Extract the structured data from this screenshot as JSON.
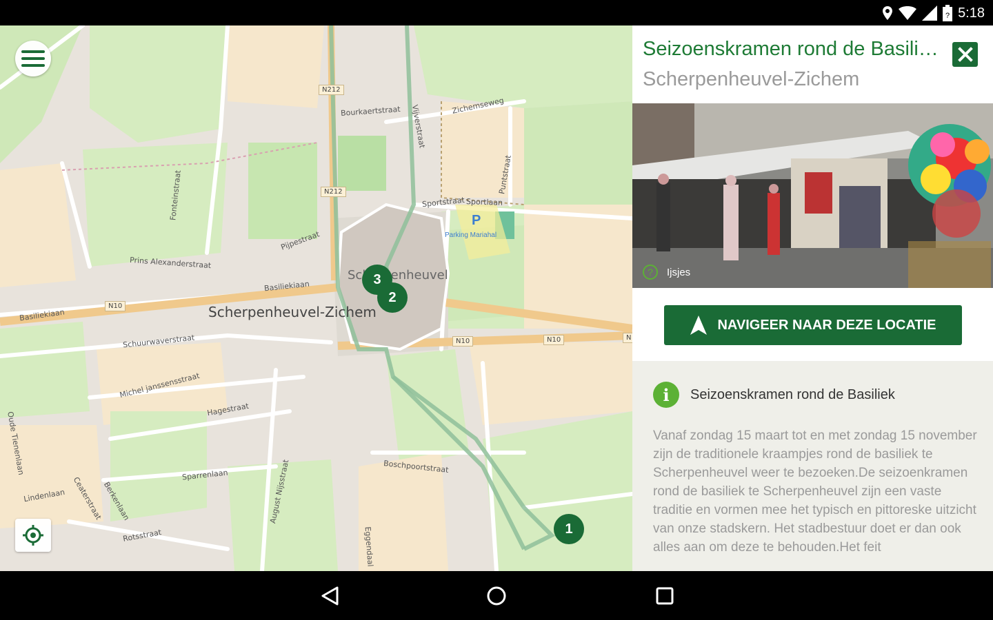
{
  "status_bar": {
    "time": "5:18",
    "icons": [
      "location-icon",
      "wifi-icon",
      "signal-icon",
      "battery-icon"
    ]
  },
  "map": {
    "town_label": "Scherpenheuvel-Zichem",
    "center_label": "Scherpenheuvel",
    "road_shields": [
      "N212",
      "N212",
      "N10",
      "N10",
      "N10",
      "N"
    ],
    "street_labels": [
      "Basiliekiaan",
      "Basiliekiaan",
      "Prins Alexanderstraat",
      "Pijpestraat",
      "Schuurwaverstraat",
      "Michel janssensstraat",
      "Hagestraat",
      "Sparrenlaan",
      "Lindenlaan",
      "Ceaterstraat",
      "Berkenlaan",
      "Rotsstraat",
      "Zichemseweg",
      "Bourkaertstraat",
      "Vijverstraat",
      "Eggendaal",
      "Boschpoortstraat",
      "August Nijsstraat",
      "Oude Tienenlaan",
      "Fonteinstraat",
      "Sportstraat",
      "Sportlaan",
      "Puntstraat"
    ],
    "parking_symbol": "P",
    "parking_label": "Parking Mariahal",
    "markers": [
      "3",
      "2",
      "1"
    ],
    "menu_icon": "hamburger-menu-icon",
    "locate_icon": "crosshair-location-icon"
  },
  "panel": {
    "title": "Seizoenskramen rond de Basiliek",
    "subtitle": "Scherpenheuvel-Zichem",
    "photo_caption": "Ijsjes",
    "navigate_label": "NAVIGEER NAAR DEZE LOCATIE",
    "info_title": "Seizoenskramen rond de Basiliek",
    "info_body": "Vanaf zondag 15 maart tot en met zondag 15 november zijn de traditionele kraampjes rond de basiliek te Scherpenheuvel weer te bezoeken.De seizoenkramen rond de basiliek te Scherpenheuvel zijn een vaste traditie en vormen mee het typisch en pittoreske uitzicht van onze stadskern. Het stadbestuur doet er dan ook alles aan om deze te behouden.Het feit"
  },
  "colors": {
    "accent_green": "#1a6b36",
    "title_green": "#1e7b35",
    "info_icon_green": "#5cb135"
  }
}
